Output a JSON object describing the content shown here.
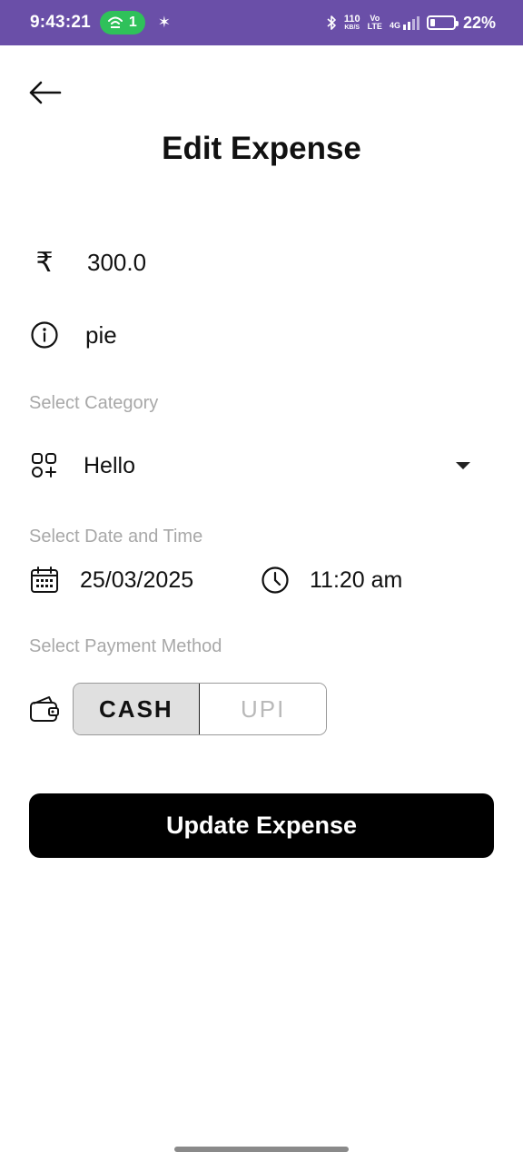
{
  "status_bar": {
    "time": "9:43:21",
    "hotspot_count": "1",
    "net_speed_value": "110",
    "net_speed_unit": "KB/S",
    "volte_top": "Vo",
    "volte_bottom": "LTE",
    "network": "4G",
    "battery_percent": "22%",
    "battery_level": 0.22,
    "bar_color": "#6a4fa8",
    "hotspot_color": "#2fc15a"
  },
  "header": {
    "back_icon": "arrow-left-icon",
    "title": "Edit Expense"
  },
  "form": {
    "amount": {
      "icon": "rupee-icon",
      "symbol": "₹",
      "value": "300.0"
    },
    "note": {
      "icon": "info-icon",
      "value": "pie"
    },
    "category": {
      "label": "Select Category",
      "icon": "category-grid-icon",
      "selected": "Hello",
      "dropdown_icon": "caret-down-icon"
    },
    "datetime": {
      "label": "Select Date and Time",
      "date_icon": "calendar-icon",
      "date": "25/03/2025",
      "time_icon": "clock-icon",
      "time": "11:20 am"
    },
    "payment": {
      "label": "Select Payment Method",
      "icon": "wallet-icon",
      "options": [
        "CASH",
        "UPI"
      ],
      "selected": "CASH"
    }
  },
  "actions": {
    "submit_label": "Update Expense"
  }
}
